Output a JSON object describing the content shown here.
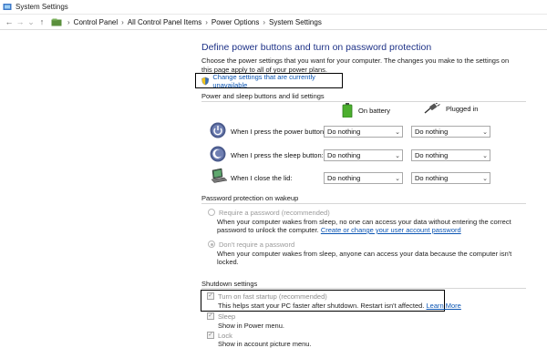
{
  "window": {
    "title": "System Settings"
  },
  "breadcrumb": [
    "Control Panel",
    "All Control Panel Items",
    "Power Options",
    "System Settings"
  ],
  "page": {
    "heading": "Define power buttons and turn on password protection",
    "description": "Choose the power settings that you want for your computer. The changes you make to the settings on this page apply to all of your power plans.",
    "change_link": "Change settings that are currently unavailable"
  },
  "power": {
    "section_title": "Power and sleep buttons and lid settings",
    "col_battery": "On battery",
    "col_plugged": "Plugged in",
    "rows": [
      {
        "label": "When I press the power button:",
        "battery": "Do nothing",
        "plugged": "Do nothing"
      },
      {
        "label": "When I press the sleep button:",
        "battery": "Do nothing",
        "plugged": "Do nothing"
      },
      {
        "label": "When I close the lid:",
        "battery": "Do nothing",
        "plugged": "Do nothing"
      }
    ]
  },
  "password": {
    "section_title": "Password protection on wakeup",
    "require_label": "Require a password (recommended)",
    "require_desc_1": "When your computer wakes from sleep, no one can access your data without entering the correct",
    "require_desc_2": "password to unlock the computer.",
    "require_link": "Create or change your user account password",
    "norequire_label": "Don't require a password",
    "norequire_desc_1": "When your computer wakes from sleep, anyone can access your data because the computer isn't",
    "norequire_desc_2": "locked."
  },
  "shutdown": {
    "section_title": "Shutdown settings",
    "fast_label": "Turn on fast startup (recommended)",
    "fast_desc": "This helps start your PC faster after shutdown. Restart isn't affected.",
    "fast_link": "Learn More",
    "sleep_label": "Sleep",
    "sleep_desc": "Show in Power menu.",
    "lock_label": "Lock",
    "lock_desc": "Show in account picture menu."
  }
}
